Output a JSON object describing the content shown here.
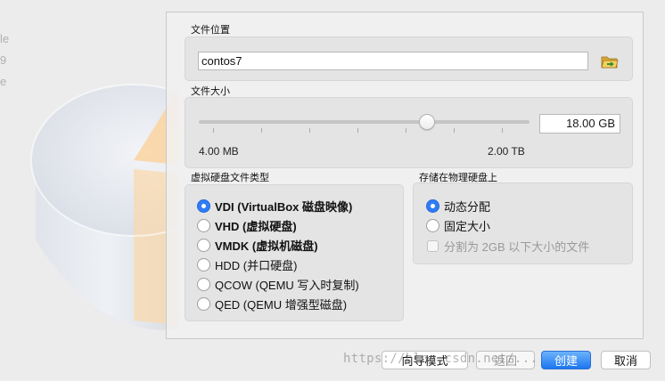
{
  "file_location": {
    "label": "文件位置",
    "value": "contos7",
    "browse_icon": "folder-open-icon"
  },
  "file_size": {
    "label": "文件大小",
    "value": "18.00 GB",
    "min_label": "4.00 MB",
    "max_label": "2.00 TB",
    "slider_fraction": 0.69
  },
  "disk_type": {
    "label": "虚拟硬盘文件类型",
    "options": [
      {
        "label": "VDI (VirtualBox 磁盘映像)",
        "selected": true
      },
      {
        "label": "VHD (虚拟硬盘)",
        "selected": false
      },
      {
        "label": "VMDK (虚拟机磁盘)",
        "selected": false
      },
      {
        "label": "HDD (并口硬盘)",
        "selected": false
      },
      {
        "label": "QCOW (QEMU 写入时复制)",
        "selected": false
      },
      {
        "label": "QED (QEMU 增强型磁盘)",
        "selected": false
      }
    ]
  },
  "storage": {
    "label": "存储在物理硬盘上",
    "options": [
      {
        "label": "动态分配",
        "selected": true
      },
      {
        "label": "固定大小",
        "selected": false
      }
    ],
    "split_label": "分割为 2GB 以下大小的文件",
    "split_checked": false
  },
  "buttons": {
    "guided_mode": "向导模式",
    "back": "返回",
    "create": "创建",
    "cancel": "取消"
  },
  "watermark": "https://blog.csdn.net/...",
  "colors": {
    "accent": "#2f7cf6",
    "art_orange": "#fbd3a0"
  }
}
